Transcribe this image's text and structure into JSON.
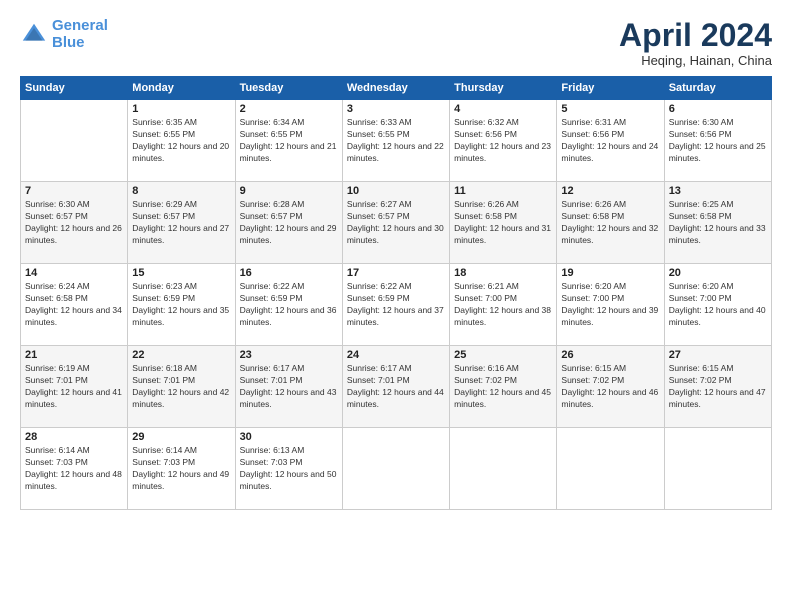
{
  "header": {
    "logo_general": "General",
    "logo_blue": "Blue",
    "title": "April 2024",
    "location": "Heqing, Hainan, China"
  },
  "weekdays": [
    "Sunday",
    "Monday",
    "Tuesday",
    "Wednesday",
    "Thursday",
    "Friday",
    "Saturday"
  ],
  "weeks": [
    [
      {
        "day": "",
        "sunrise": "",
        "sunset": "",
        "daylight": ""
      },
      {
        "day": "1",
        "sunrise": "Sunrise: 6:35 AM",
        "sunset": "Sunset: 6:55 PM",
        "daylight": "Daylight: 12 hours and 20 minutes."
      },
      {
        "day": "2",
        "sunrise": "Sunrise: 6:34 AM",
        "sunset": "Sunset: 6:55 PM",
        "daylight": "Daylight: 12 hours and 21 minutes."
      },
      {
        "day": "3",
        "sunrise": "Sunrise: 6:33 AM",
        "sunset": "Sunset: 6:55 PM",
        "daylight": "Daylight: 12 hours and 22 minutes."
      },
      {
        "day": "4",
        "sunrise": "Sunrise: 6:32 AM",
        "sunset": "Sunset: 6:56 PM",
        "daylight": "Daylight: 12 hours and 23 minutes."
      },
      {
        "day": "5",
        "sunrise": "Sunrise: 6:31 AM",
        "sunset": "Sunset: 6:56 PM",
        "daylight": "Daylight: 12 hours and 24 minutes."
      },
      {
        "day": "6",
        "sunrise": "Sunrise: 6:30 AM",
        "sunset": "Sunset: 6:56 PM",
        "daylight": "Daylight: 12 hours and 25 minutes."
      }
    ],
    [
      {
        "day": "7",
        "sunrise": "Sunrise: 6:30 AM",
        "sunset": "Sunset: 6:57 PM",
        "daylight": "Daylight: 12 hours and 26 minutes."
      },
      {
        "day": "8",
        "sunrise": "Sunrise: 6:29 AM",
        "sunset": "Sunset: 6:57 PM",
        "daylight": "Daylight: 12 hours and 27 minutes."
      },
      {
        "day": "9",
        "sunrise": "Sunrise: 6:28 AM",
        "sunset": "Sunset: 6:57 PM",
        "daylight": "Daylight: 12 hours and 29 minutes."
      },
      {
        "day": "10",
        "sunrise": "Sunrise: 6:27 AM",
        "sunset": "Sunset: 6:57 PM",
        "daylight": "Daylight: 12 hours and 30 minutes."
      },
      {
        "day": "11",
        "sunrise": "Sunrise: 6:26 AM",
        "sunset": "Sunset: 6:58 PM",
        "daylight": "Daylight: 12 hours and 31 minutes."
      },
      {
        "day": "12",
        "sunrise": "Sunrise: 6:26 AM",
        "sunset": "Sunset: 6:58 PM",
        "daylight": "Daylight: 12 hours and 32 minutes."
      },
      {
        "day": "13",
        "sunrise": "Sunrise: 6:25 AM",
        "sunset": "Sunset: 6:58 PM",
        "daylight": "Daylight: 12 hours and 33 minutes."
      }
    ],
    [
      {
        "day": "14",
        "sunrise": "Sunrise: 6:24 AM",
        "sunset": "Sunset: 6:58 PM",
        "daylight": "Daylight: 12 hours and 34 minutes."
      },
      {
        "day": "15",
        "sunrise": "Sunrise: 6:23 AM",
        "sunset": "Sunset: 6:59 PM",
        "daylight": "Daylight: 12 hours and 35 minutes."
      },
      {
        "day": "16",
        "sunrise": "Sunrise: 6:22 AM",
        "sunset": "Sunset: 6:59 PM",
        "daylight": "Daylight: 12 hours and 36 minutes."
      },
      {
        "day": "17",
        "sunrise": "Sunrise: 6:22 AM",
        "sunset": "Sunset: 6:59 PM",
        "daylight": "Daylight: 12 hours and 37 minutes."
      },
      {
        "day": "18",
        "sunrise": "Sunrise: 6:21 AM",
        "sunset": "Sunset: 7:00 PM",
        "daylight": "Daylight: 12 hours and 38 minutes."
      },
      {
        "day": "19",
        "sunrise": "Sunrise: 6:20 AM",
        "sunset": "Sunset: 7:00 PM",
        "daylight": "Daylight: 12 hours and 39 minutes."
      },
      {
        "day": "20",
        "sunrise": "Sunrise: 6:20 AM",
        "sunset": "Sunset: 7:00 PM",
        "daylight": "Daylight: 12 hours and 40 minutes."
      }
    ],
    [
      {
        "day": "21",
        "sunrise": "Sunrise: 6:19 AM",
        "sunset": "Sunset: 7:01 PM",
        "daylight": "Daylight: 12 hours and 41 minutes."
      },
      {
        "day": "22",
        "sunrise": "Sunrise: 6:18 AM",
        "sunset": "Sunset: 7:01 PM",
        "daylight": "Daylight: 12 hours and 42 minutes."
      },
      {
        "day": "23",
        "sunrise": "Sunrise: 6:17 AM",
        "sunset": "Sunset: 7:01 PM",
        "daylight": "Daylight: 12 hours and 43 minutes."
      },
      {
        "day": "24",
        "sunrise": "Sunrise: 6:17 AM",
        "sunset": "Sunset: 7:01 PM",
        "daylight": "Daylight: 12 hours and 44 minutes."
      },
      {
        "day": "25",
        "sunrise": "Sunrise: 6:16 AM",
        "sunset": "Sunset: 7:02 PM",
        "daylight": "Daylight: 12 hours and 45 minutes."
      },
      {
        "day": "26",
        "sunrise": "Sunrise: 6:15 AM",
        "sunset": "Sunset: 7:02 PM",
        "daylight": "Daylight: 12 hours and 46 minutes."
      },
      {
        "day": "27",
        "sunrise": "Sunrise: 6:15 AM",
        "sunset": "Sunset: 7:02 PM",
        "daylight": "Daylight: 12 hours and 47 minutes."
      }
    ],
    [
      {
        "day": "28",
        "sunrise": "Sunrise: 6:14 AM",
        "sunset": "Sunset: 7:03 PM",
        "daylight": "Daylight: 12 hours and 48 minutes."
      },
      {
        "day": "29",
        "sunrise": "Sunrise: 6:14 AM",
        "sunset": "Sunset: 7:03 PM",
        "daylight": "Daylight: 12 hours and 49 minutes."
      },
      {
        "day": "30",
        "sunrise": "Sunrise: 6:13 AM",
        "sunset": "Sunset: 7:03 PM",
        "daylight": "Daylight: 12 hours and 50 minutes."
      },
      {
        "day": "",
        "sunrise": "",
        "sunset": "",
        "daylight": ""
      },
      {
        "day": "",
        "sunrise": "",
        "sunset": "",
        "daylight": ""
      },
      {
        "day": "",
        "sunrise": "",
        "sunset": "",
        "daylight": ""
      },
      {
        "day": "",
        "sunrise": "",
        "sunset": "",
        "daylight": ""
      }
    ]
  ]
}
